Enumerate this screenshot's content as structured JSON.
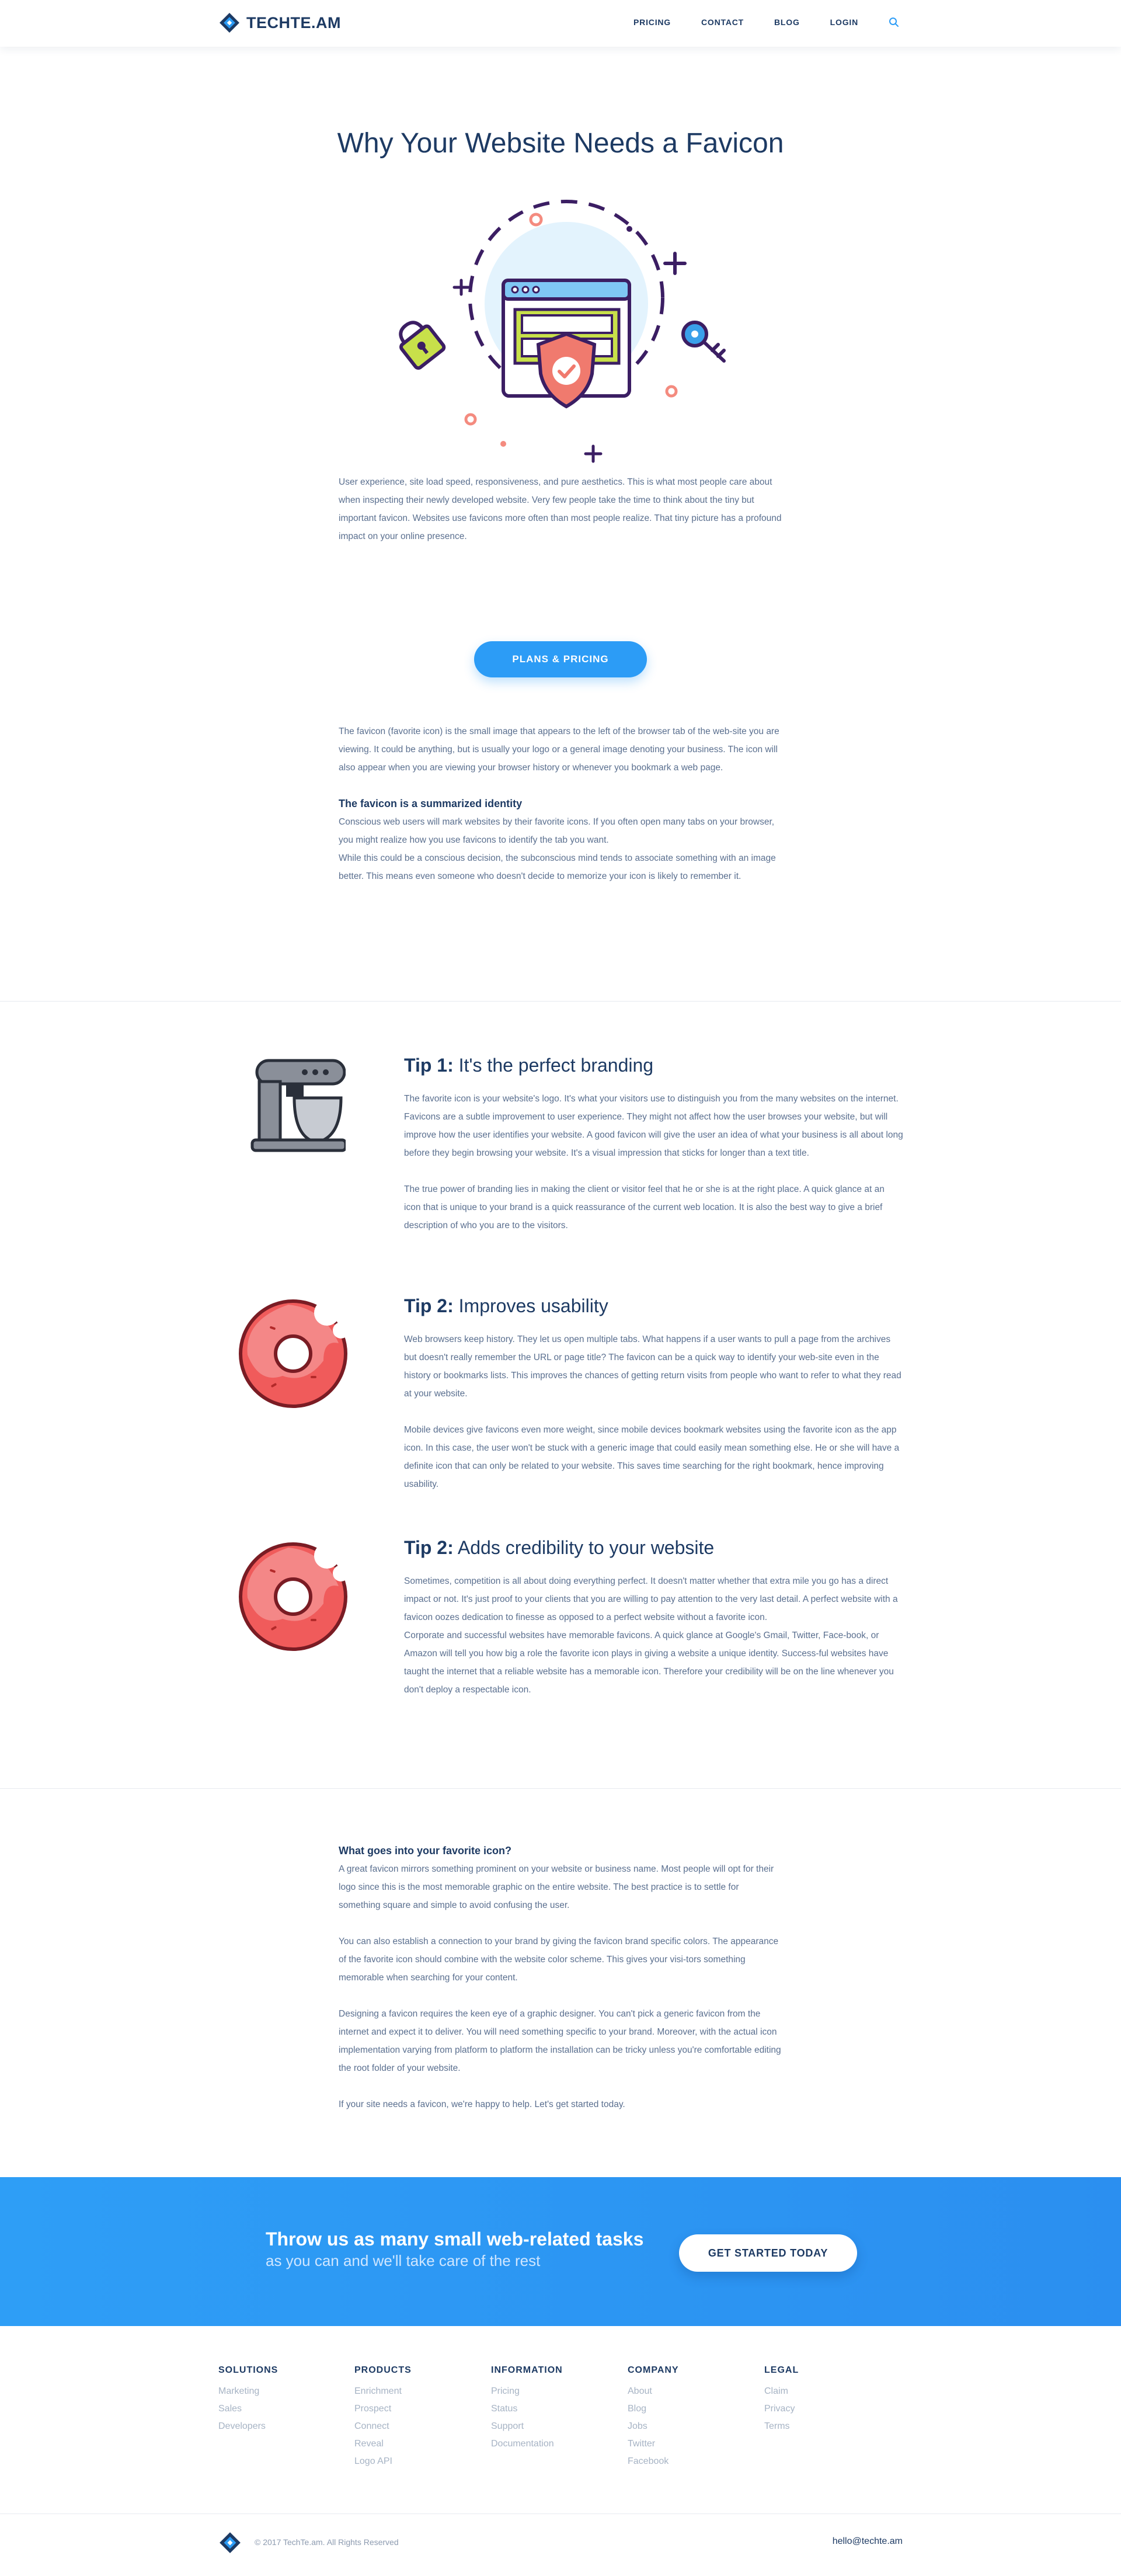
{
  "header": {
    "logo_text": "TECHTE.AM",
    "nav": [
      "PRICING",
      "CONTACT",
      "BLOG",
      "LOGIN"
    ]
  },
  "hero": {
    "title": "Why Your Website Needs a Favicon"
  },
  "intro": {
    "p1": "User experience, site load speed, responsiveness, and pure aesthetics. This is what most people care about when inspecting their newly developed website. Very few people take the time to think about the tiny but important favicon. Websites use favicons more often than most people realize. That tiny picture has a profound impact on your online presence.",
    "button": "PLANS & PRICING",
    "p2": "The favicon (favorite icon) is the small image that appears to the left of the browser tab of the web-site you are viewing. It could be anything, but is usually your logo or a general image denoting your business. The icon will also appear when you are viewing your browser history or whenever you bookmark a web page.",
    "h_identity": "The favicon is a summarized identity",
    "p3": "Conscious web users will mark websites by their favorite icons. If you often open many tabs on your browser, you might realize how you use favicons to identify the tab you want.",
    "p4": "While this could be a conscious decision, the subconscious mind tends to associate something with an image better. This means even someone who doesn't decide to memorize your icon is likely to remember it."
  },
  "tips": [
    {
      "label": "Tip 1:",
      "title": "It's the perfect branding",
      "paragraphs": [
        "The favorite icon is your website's logo. It's what your visitors use to distinguish you from the many websites on the internet. Favicons are a subtle improvement to user experience. They might not affect how the user browses your website, but will improve how the user identifies your website. A good favicon will give the user an idea of what your business is all about long before they begin browsing your website. It's a visual impression that sticks for longer than a text title.",
        "The true power of branding lies in making the client or visitor feel that he or she is at the right place. A quick glance at an icon that is unique to your brand is a quick reassurance of the current web location. It is also the best way to give a brief description of who you are to the visitors."
      ]
    },
    {
      "label": "Tip 2:",
      "title": "Improves usability",
      "paragraphs": [
        "Web browsers keep history. They let us open multiple tabs. What happens if a user wants to pull a page from the archives but doesn't really remember the URL or page title? The favicon can be a quick way to identify your web-site even in the history or bookmarks lists. This improves the chances of getting return visits from people who want to refer to what they read at your website.",
        "Mobile devices give favicons even more weight, since mobile devices bookmark websites using the favorite icon as the app icon. In this case, the user won't be stuck with a generic image that could easily mean something else. He or she will have a definite icon that can only be related to your website. This saves time searching for the right bookmark, hence improving usability."
      ]
    },
    {
      "label": "Tip 2:",
      "title": "Adds credibility to your website",
      "paragraphs": [
        "Sometimes, competition is all about doing everything perfect. It doesn't matter whether that extra mile you go has a direct impact or not. It's just proof to your clients that you are willing to pay attention to the very last detail. A perfect website with a favicon oozes dedication to finesse as opposed to a perfect website without a favorite icon.",
        "Corporate and successful websites have memorable favicons. A quick glance at Google's Gmail, Twitter, Face-book, or Amazon will tell you how big a role the favorite icon plays in giving a website a unique identity. Success-ful websites have taught the internet that a reliable website has a memorable icon. Therefore your credibility will be on the line whenever you don't deploy a respectable icon."
      ]
    }
  ],
  "whatgoes": {
    "heading": "What goes into your favorite icon?",
    "p1": "A great favicon mirrors something prominent on your website or business name. Most people will opt for their logo since this is the most memorable graphic on the entire website. The best practice is to settle for something square and simple to avoid confusing the user.",
    "p2": "You can also establish a connection to your brand by giving the favicon brand specific colors. The appearance of the favorite icon should combine with the website color scheme. This gives your visi-tors something memorable when searching for your content.",
    "p3": "Designing a favicon requires the keen eye of a graphic designer. You can't pick a generic favicon from the internet and expect it to deliver. You will need something specific to your brand. Moreover, with the actual icon implementation varying from platform to platform the installation can be tricky unless you're comfortable editing the root folder of your website.",
    "p4": "If your site needs a favicon, we're happy to help. Let's get started today."
  },
  "cta": {
    "title": "Throw us as many small web-related tasks",
    "subtitle": "as you can and we'll take care of the rest",
    "button": "GET STARTED TODAY"
  },
  "footer": {
    "columns": [
      {
        "title": "SOLUTIONS",
        "links": [
          "Marketing",
          "Sales",
          "Developers"
        ]
      },
      {
        "title": "PRODUCTS",
        "links": [
          "Enrichment",
          "Prospect",
          "Connect",
          "Reveal",
          "Logo API"
        ]
      },
      {
        "title": "INFORMATION",
        "links": [
          "Pricing",
          "Status",
          "Support",
          "Documentation"
        ]
      },
      {
        "title": "COMPANY",
        "links": [
          "About",
          "Blog",
          "Jobs",
          "Twitter",
          "Facebook"
        ]
      },
      {
        "title": "LEGAL",
        "links": [
          "Claim",
          "Privacy",
          "Terms"
        ]
      }
    ],
    "copyright": "© 2017 TechTe.am. All Rights Reserved",
    "email": "hello@techte.am"
  },
  "colors": {
    "accent": "#2c9cf6",
    "navy": "#1d3a63",
    "text": "#5a6f8f"
  }
}
